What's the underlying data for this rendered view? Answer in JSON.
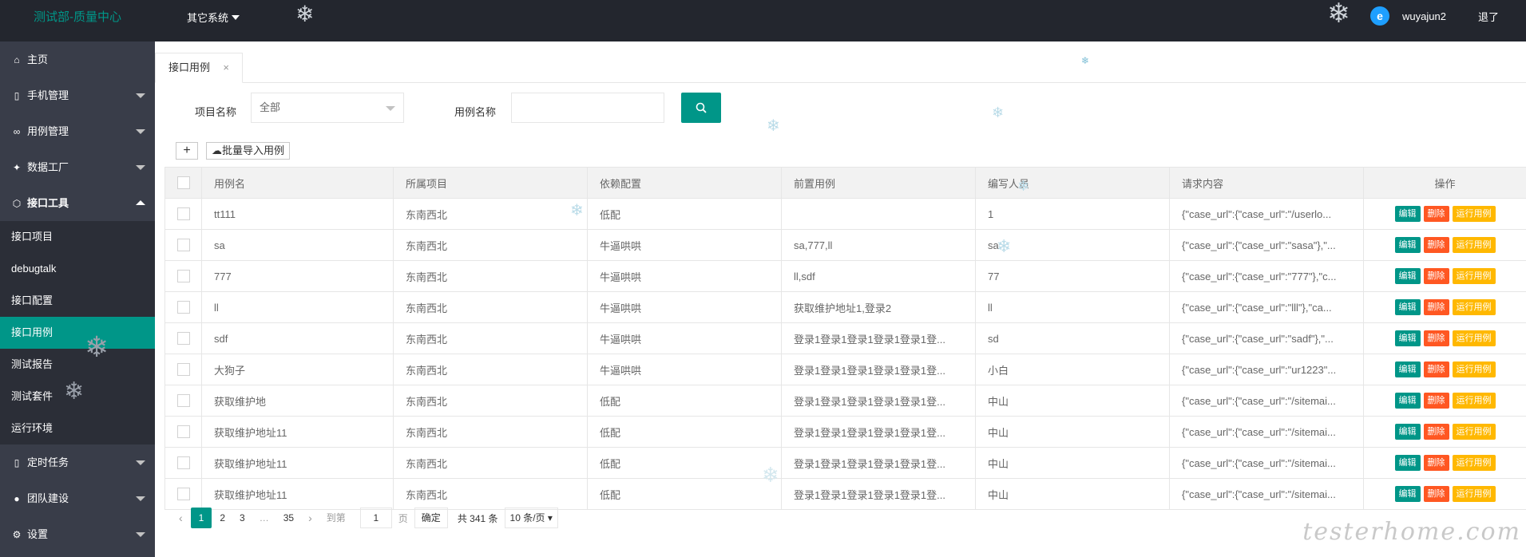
{
  "header": {
    "brand": "测试部-质量中心",
    "system_menu": "其它系统",
    "username": "wuyajun2",
    "logout": "退了"
  },
  "sidebar": {
    "items": [
      {
        "label": "主页",
        "icon": "home-icon"
      },
      {
        "label": "手机管理",
        "icon": "phone-icon"
      },
      {
        "label": "用例管理",
        "icon": "binoculars-icon"
      },
      {
        "label": "数据工厂",
        "icon": "factory-icon"
      },
      {
        "label": "接口工具",
        "icon": "cube-icon"
      },
      {
        "label": "定时任务",
        "icon": "phone-icon"
      },
      {
        "label": "团队建设",
        "icon": "user-icon"
      },
      {
        "label": "设置",
        "icon": "gear-icon"
      }
    ],
    "subitems": [
      "接口项目",
      "debugtalk",
      "接口配置",
      "接口用例",
      "测试报告",
      "测试套件",
      "运行环境"
    ]
  },
  "tab": {
    "label": "接口用例"
  },
  "filter": {
    "project_label": "项目名称",
    "project_value": "全部",
    "case_label": "用例名称",
    "case_value": ""
  },
  "toolbar": {
    "add": "+",
    "import": "批量导入用例"
  },
  "table": {
    "headers": [
      "用例名",
      "所属项目",
      "依赖配置",
      "前置用例",
      "编写人员",
      "请求内容",
      "操作"
    ],
    "rows": [
      [
        "tt111",
        "东南西北",
        "低配",
        "",
        "1",
        "{\"case_url\":{\"case_url\":\"/userlo..."
      ],
      [
        "sa",
        "东南西北",
        "牛逼哄哄",
        "sa,777,ll",
        "sa",
        "{\"case_url\":{\"case_url\":\"sasa\"},\"..."
      ],
      [
        "777",
        "东南西北",
        "牛逼哄哄",
        "ll,sdf",
        "77",
        "{\"case_url\":{\"case_url\":\"777\"},\"c..."
      ],
      [
        "ll",
        "东南西北",
        "牛逼哄哄",
        "获取维护地址1,登录2",
        "ll",
        "{\"case_url\":{\"case_url\":\"lll\"},\"ca..."
      ],
      [
        "sdf",
        "东南西北",
        "牛逼哄哄",
        "登录1登录1登录1登录1登录1登...",
        "sd",
        "{\"case_url\":{\"case_url\":\"sadf\"},\"..."
      ],
      [
        "大狗子",
        "东南西北",
        "牛逼哄哄",
        "登录1登录1登录1登录1登录1登...",
        "小白",
        "{\"case_url\":{\"case_url\":\"ur1223\"..."
      ],
      [
        "获取维护地",
        "东南西北",
        "低配",
        "登录1登录1登录1登录1登录1登...",
        "中山",
        "{\"case_url\":{\"case_url\":\"/sitemai..."
      ],
      [
        "获取维护地址11",
        "东南西北",
        "低配",
        "登录1登录1登录1登录1登录1登...",
        "中山",
        "{\"case_url\":{\"case_url\":\"/sitemai..."
      ],
      [
        "获取维护地址11",
        "东南西北",
        "低配",
        "登录1登录1登录1登录1登录1登...",
        "中山",
        "{\"case_url\":{\"case_url\":\"/sitemai..."
      ],
      [
        "获取维护地址11",
        "东南西北",
        "低配",
        "登录1登录1登录1登录1登录1登...",
        "中山",
        "{\"case_url\":{\"case_url\":\"/sitemai..."
      ]
    ],
    "ops": {
      "edit": "编辑",
      "delete": "删除",
      "run": "运行用例"
    }
  },
  "pager": {
    "prev": "‹",
    "pages": [
      "1",
      "2",
      "3"
    ],
    "ellipsis": "…",
    "last": "35",
    "next": "›",
    "goto_label": "到第",
    "goto_value": "1",
    "page_unit": "页",
    "confirm": "确定",
    "total": "共 341 条",
    "page_size": "10 条/页"
  },
  "watermark": "testerhome.com",
  "colors": {
    "primary": "#009688",
    "danger": "#ff5722",
    "warn": "#ffb800",
    "topbar": "#23262e",
    "sidebar": "#393d49"
  }
}
